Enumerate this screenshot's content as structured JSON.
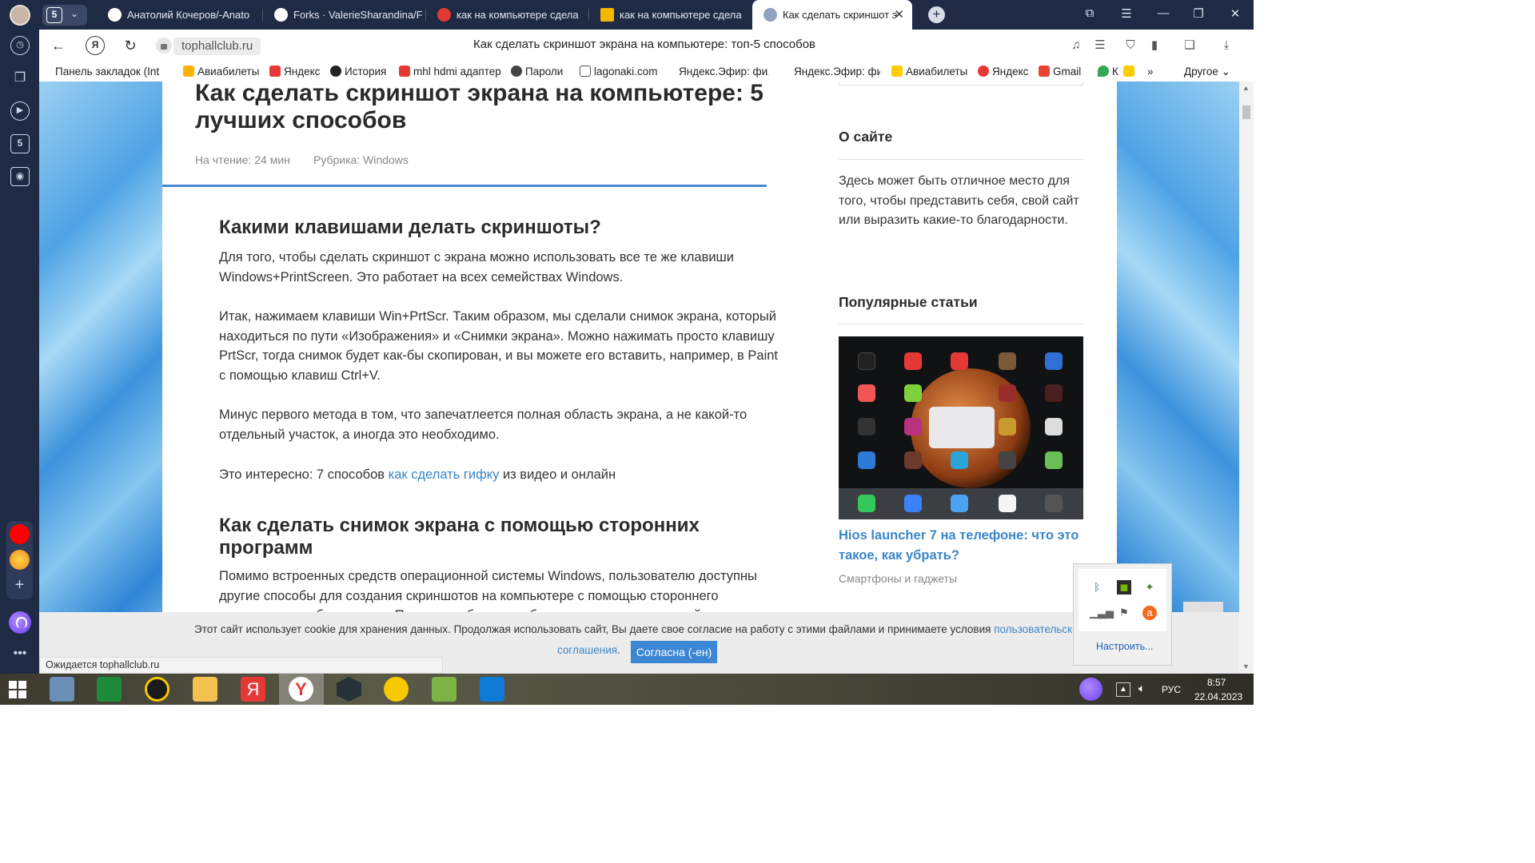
{
  "tabs": {
    "counter": "5",
    "items": [
      {
        "label": "Анатолий Кочеров/-Anato",
        "color": "#ffffff"
      },
      {
        "label": "Forks · ValerieSharandina/F",
        "color": "#ffffff"
      },
      {
        "label": "как на компьютере сдела",
        "color": "#e53935"
      },
      {
        "label": "как на компьютере сдела",
        "color": "#f5b800"
      },
      {
        "label": "Как сделать скриншот э",
        "color": "#8fa3bf"
      }
    ]
  },
  "address": {
    "domain": "tophallclub.ru",
    "title": "Как сделать скриншот экрана на компьютере: топ-5 способов"
  },
  "bookmarks": {
    "panel": "Панель закладок (Int",
    "items": [
      "Авиабилеты",
      "Яндекс",
      "История",
      "mhl hdmi адаптер",
      "Пароли",
      "lagonaki.com",
      "Яндекс.Эфир: фил",
      "Яндекс.Эфир: фил",
      "Авиабилеты",
      "Яндекс",
      "Gmail",
      "К"
    ],
    "more": "»",
    "other": "Другое"
  },
  "article": {
    "title": "Как сделать скриншот экрана на компьютере: 5 лучших способов",
    "reading_time": "На чтение: 24 мин",
    "rubric": "Рубрика: Windows",
    "h2_1": "Какими клавишами делать скриншоты?",
    "p1": "Для того, чтобы сделать скриншот с экрана можно использовать все те же клавиши Windows+PrintScreen. Это работает на всех семействах Windows.",
    "p2": "Итак, нажимаем клавиши Win+PrtScr. Таким образом, мы сделали снимок экрана, который находиться по пути «Изображения» и «Снимки экрана». Можно нажимать просто клавишу PrtScr, тогда снимок будет как-бы скопирован, и вы можете его вставить, например, в Paint с помощью клавиш Ctrl+V.",
    "p3": "Минус первого метода в том, что запечатлеется полная область экрана, а не какой-то отдельный участок, а иногда это необходимо.",
    "p4_prefix": "Это интересно: 7 способов ",
    "p4_link": "как сделать гифку",
    "p4_suffix": " из видео и онлайн",
    "h2_2": "Как сделать снимок экрана с помощью сторонних программ",
    "p5": "Помимо встроенных средств операционной системы Windows, пользователю доступны другие способы для создания скриншотов на компьютере с помощью стороннего программного обеспечения. Принцип работы подобных программ одинаковый"
  },
  "sidebar": {
    "about_title": "О сайте",
    "about_text": "Здесь может быть отличное место для того, чтобы представить себя, свой сайт или выразить какие-то благодарности.",
    "popular_title": "Популярные статьи",
    "popular_link": "Hios launcher 7 на телефоне: что это такое, как убрать?",
    "popular_cat": "Смартфоны и гаджеты"
  },
  "cookie": {
    "text": "Этот сайт использует cookie для хранения данных. Продолжая использовать сайт, Вы даете свое согласие на работу с этими файлами и принимаете условия ",
    "link1": "пользовательско",
    "link2": "соглашения",
    "dot": ".",
    "button": "Согласна (-ен)"
  },
  "status": "Ожидается tophallclub.ru",
  "tray": {
    "configure": "Настроить...",
    "lang": "РУС",
    "time": "8:57",
    "date": "22.04.2023"
  }
}
